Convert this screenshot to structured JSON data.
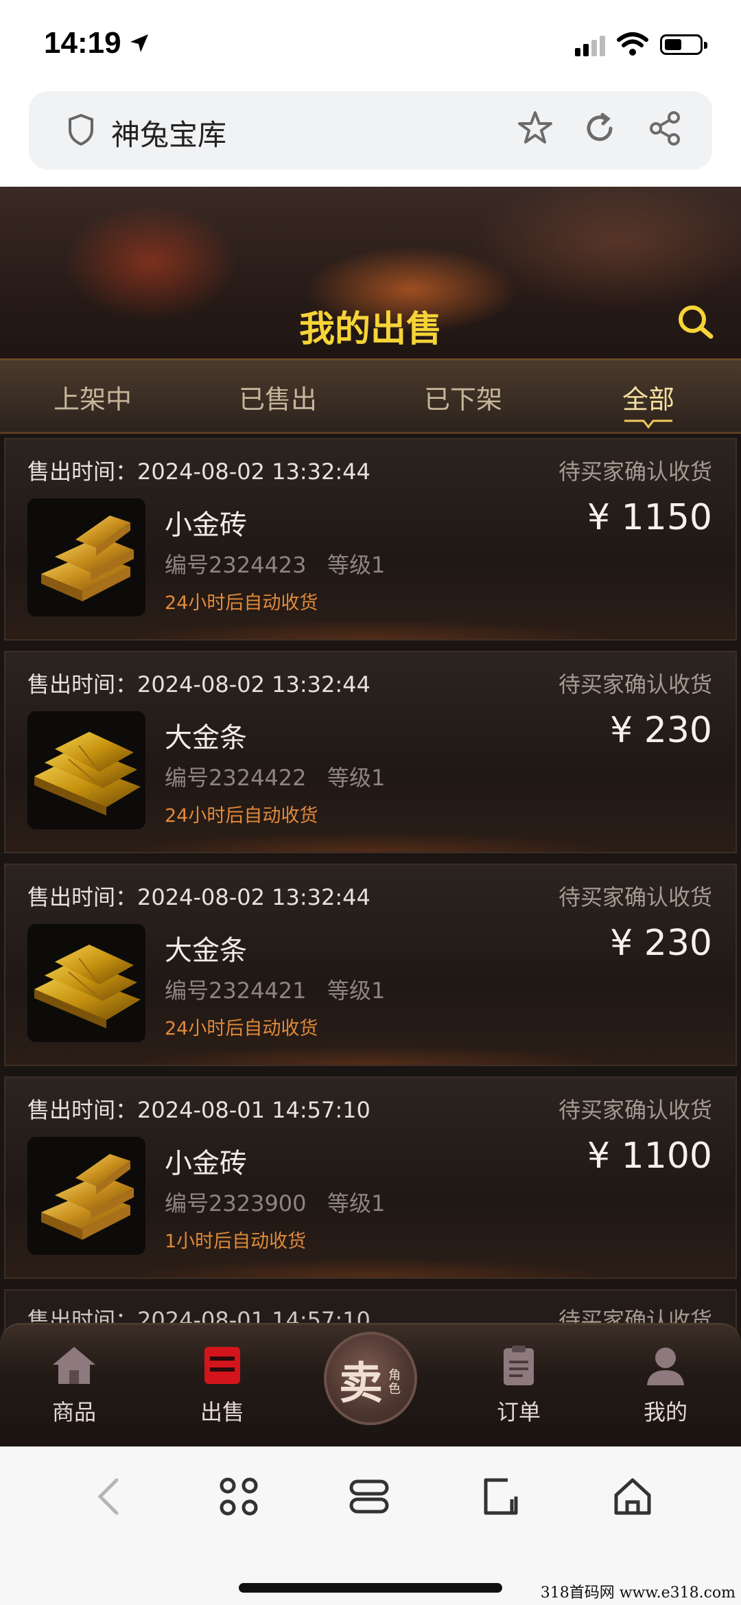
{
  "status_bar": {
    "time": "14:19"
  },
  "browser": {
    "page_title": "神兔宝库"
  },
  "header": {
    "title": "我的出售"
  },
  "tabs": [
    {
      "label": "上架中",
      "active": false
    },
    {
      "label": "已售出",
      "active": false
    },
    {
      "label": "已下架",
      "active": false
    },
    {
      "label": "全部",
      "active": true
    }
  ],
  "orders": [
    {
      "time_label": "售出时间：",
      "time": "2024-08-02 13:32:44",
      "status": "待买家确认收货",
      "name": "小金砖",
      "code": "编号2324423",
      "level": "等级1",
      "auto": "24小时后自动收货",
      "price": "¥ 1150",
      "icon": "gold-brick-icon"
    },
    {
      "time_label": "售出时间：",
      "time": "2024-08-02 13:32:44",
      "status": "待买家确认收货",
      "name": "大金条",
      "code": "编号2324422",
      "level": "等级1",
      "auto": "24小时后自动收货",
      "price": "¥ 230",
      "icon": "gold-bar-icon"
    },
    {
      "time_label": "售出时间：",
      "time": "2024-08-02 13:32:44",
      "status": "待买家确认收货",
      "name": "大金条",
      "code": "编号2324421",
      "level": "等级1",
      "auto": "24小时后自动收货",
      "price": "¥ 230",
      "icon": "gold-bar-icon"
    },
    {
      "time_label": "售出时间：",
      "time": "2024-08-01 14:57:10",
      "status": "待买家确认收货",
      "name": "小金砖",
      "code": "编号2323900",
      "level": "等级1",
      "auto": "1小时后自动收货",
      "price": "¥ 1100",
      "icon": "gold-brick-icon"
    }
  ],
  "partial_order": {
    "time_label": "售出时间：",
    "time": "2024-08-01 14:57:10",
    "status": "待买家确认收货"
  },
  "bottom_nav": {
    "items": [
      {
        "label": "商品",
        "icon": "house-icon"
      },
      {
        "label": "出售",
        "icon": "sell-box-icon",
        "active": true
      },
      {
        "label": "订单",
        "icon": "clipboard-icon"
      },
      {
        "label": "我的",
        "icon": "person-icon"
      }
    ],
    "sell_button": {
      "main": "卖",
      "sub": "角色"
    }
  },
  "watermark": "318首码网 www.e318.com",
  "colors": {
    "title_gold": "#f6d438",
    "auto_orange": "#e08a3a",
    "tab_active": "#f6e1a2"
  }
}
